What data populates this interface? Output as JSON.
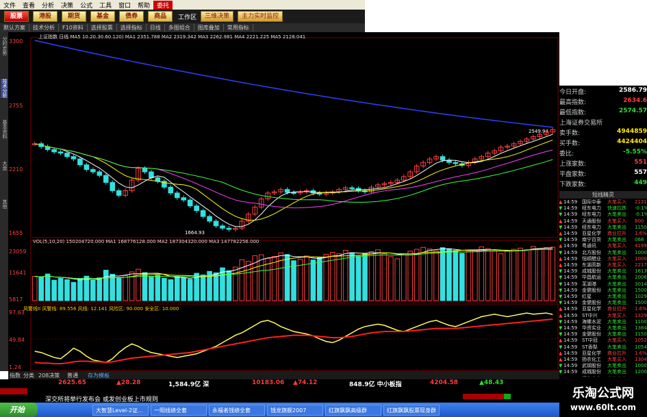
{
  "menu": [
    "文件",
    "查看",
    "分析",
    "决策",
    "公式",
    "工具",
    "窗口",
    "帮助",
    "委托"
  ],
  "toolbar": {
    "buttons": [
      "股票",
      "港股",
      "期货",
      "基金",
      "债券",
      "商品"
    ],
    "workspace_label": "工作区",
    "extra": [
      "三维决策",
      "主力实时监控"
    ]
  },
  "subtoolbar": [
    "默认方案",
    "技术分析",
    "F10资料",
    "选择股票",
    "选择指标",
    "日线",
    "多图组合",
    "图库叠加",
    "常用指标"
  ],
  "left_tabs": [
    "分时走势",
    "技术分析",
    "基本资料",
    "大盘",
    "其他"
  ],
  "chart": {
    "title_line": "上证指数 日线 MA5 10.20.30.60.120) MA1 2351.788 MA2 2319.342 MA3 2262.981 MA4 2221.225 MA5 2128.041",
    "price_ticks": [
      "3300",
      "2755",
      "2210",
      "1655"
    ],
    "low_label": "1664.93",
    "high_label": "2549.94",
    "vol_title": "VOL(5,10,20) 150204720.000 MA1 168776128.000 MA2 187304320.000 MA3 147782256.000",
    "vol_ticks": [
      "23059",
      "11641",
      "5817"
    ],
    "ind_title": "风警线II 风警线: 89.556 风线: 12.141 风险区: 90.000 安全区: 10.000",
    "ind_ticks": [
      "97.63",
      "49.84",
      "1.24"
    ],
    "date_ticks": [
      "2008/08",
      "09",
      "10",
      "11",
      "12",
      "2009/01",
      "02",
      "03"
    ]
  },
  "quote": {
    "rows": [
      {
        "k": "今日开盘:",
        "v": "2586.79",
        "c": "wht"
      },
      {
        "k": "最高指数:",
        "v": "2634.6",
        "c": "red"
      },
      {
        "k": "最低指数:",
        "v": "2574.57",
        "c": "grn"
      },
      {
        "k": "上海证券交易所",
        "v": "",
        "c": "wht"
      },
      {
        "k": "卖手数:",
        "v": "4944859",
        "c": "yel"
      },
      {
        "k": "买手数:",
        "v": "4424404",
        "c": "yel"
      },
      {
        "k": "委比:",
        "v": "-5.55%",
        "c": "grn"
      },
      {
        "k": "上涨家数:",
        "v": "551",
        "c": "red"
      },
      {
        "k": "平盘家数:",
        "v": "557",
        "c": "wht"
      },
      {
        "k": "下跌家数:",
        "v": "449",
        "c": "grn"
      }
    ],
    "trade_header": "短线精灵",
    "trades": [
      {
        "t": "14:59",
        "n": "国际中泰",
        "a": "大笔买入",
        "v": "2131"
      },
      {
        "t": "14:59",
        "n": "纽东电力",
        "a": "快速拉跌",
        "v": "-0.1%"
      },
      {
        "t": "14:59",
        "n": "纽东电力",
        "a": "大笔卖出",
        "v": "-0.1%"
      },
      {
        "t": "14:59",
        "n": "天通股份",
        "a": "大笔买入",
        "v": "800"
      },
      {
        "t": "14:59",
        "n": "纽东电力",
        "a": "大笔卖出",
        "v": "1150"
      },
      {
        "t": "14:59",
        "n": "亚星化学",
        "a": "商业拉升",
        "v": "1.6%"
      },
      {
        "t": "14:59",
        "n": "南宁百货",
        "a": "大笔卖出",
        "v": "068"
      },
      {
        "t": "14:59",
        "n": "粤通讯",
        "a": "大笔买入",
        "v": "4199"
      },
      {
        "t": "14:59",
        "n": "北方股份",
        "a": "大笔卖出",
        "v": "1000"
      },
      {
        "t": "14:59",
        "n": "恒顺醋业",
        "a": "大笔买入",
        "v": "1000"
      },
      {
        "t": "14:59",
        "n": "东湖高新",
        "a": "大笔买入",
        "v": "2217"
      },
      {
        "t": "14:59",
        "n": "成城股份",
        "a": "大笔卖出",
        "v": "1613"
      },
      {
        "t": "14:59",
        "n": "华昌航运",
        "a": "大笔卖出",
        "v": "2006"
      },
      {
        "t": "14:59",
        "n": "芜湖港",
        "a": "大笔卖出",
        "v": "3014"
      },
      {
        "t": "14:59",
        "n": "金健股份",
        "a": "大笔卖出",
        "v": "1500"
      },
      {
        "t": "14:59",
        "n": "红星",
        "a": "大笔卖出",
        "v": "1029"
      },
      {
        "t": "14:59",
        "n": "金健股份",
        "a": "大笔卖出",
        "v": "1500"
      },
      {
        "t": "14:59",
        "n": "亚星化学",
        "a": "商业拉升",
        "v": "1.6%"
      },
      {
        "t": "14:59",
        "n": "ST中兴",
        "a": "大笔买入",
        "v": "1329"
      },
      {
        "t": "14:59",
        "n": "海螺水泥",
        "a": "大笔卖出",
        "v": "1100"
      },
      {
        "t": "14:59",
        "n": "华资实业",
        "a": "大笔卖出",
        "v": "1384"
      },
      {
        "t": "14:59",
        "n": "金健股份",
        "a": "大笔卖出",
        "v": "1150"
      },
      {
        "t": "14:59",
        "n": "ST中冠",
        "a": "大笔买入",
        "v": "1052"
      },
      {
        "t": "14:59",
        "n": "ST香梨",
        "a": "大笔卖出",
        "v": "1054"
      },
      {
        "t": "14:59",
        "n": "亚星化学",
        "a": "商业拉升",
        "v": "1.6%"
      },
      {
        "t": "14:59",
        "n": "扬农化工",
        "a": "大笔买入",
        "v": "1304"
      },
      {
        "t": "14:59",
        "n": "武钢股份",
        "a": "大笔卖出",
        "v": "1000"
      },
      {
        "t": "14:59",
        "n": "成城股份",
        "a": "大笔卖出",
        "v": "1200"
      },
      {
        "t": "14:59",
        "n": "闽东电力",
        "a": "大笔卖出",
        "v": "1150"
      }
    ]
  },
  "bottom_tabs": [
    "指数",
    "分类",
    "208决策",
    "普通",
    "存为模板"
  ],
  "status": {
    "s1": "2625.65",
    "s2": "▲28.28",
    "s3": "1,584.9亿 深",
    "s4": "10183.06",
    "s5": "▲74.12",
    "s6": "848.9亿 中小板指",
    "s7": "4204.58",
    "s8": "▲48.43"
  },
  "ticker_text": "深交所将举行发布会 或发创业板上市规则",
  "taskbar": {
    "start": "开始",
    "tasks": [
      "大智慧Level-2证...",
      "一阳线绩全套",
      "永福者钱绩全套",
      "钱龙旗舰2007",
      "红旗飘飘高级群",
      "红旗飘飘股票现身群"
    ]
  },
  "promo": {
    "title": "乐淘公式网",
    "url": "www.60lt.com"
  },
  "chart_data": {
    "type": "candlestick",
    "price_range": [
      1655,
      3300
    ],
    "closes": [
      2420,
      2395,
      2370,
      2350,
      2340,
      2310,
      2290,
      2240,
      2200,
      2180,
      2150,
      2090,
      2020,
      1980,
      2020,
      2110,
      2210,
      2180,
      2130,
      2100,
      2050,
      2000,
      1960,
      1940,
      1890,
      1850,
      1800,
      1760,
      1720,
      1700,
      1690,
      1700,
      1760,
      1820,
      1880,
      1950,
      2000,
      2010,
      2030,
      2005,
      2000,
      2010,
      2020,
      2000,
      1990,
      2000,
      2010,
      2030,
      2045,
      2040,
      2020,
      2010,
      2050,
      2070,
      2080,
      2090,
      2110,
      2140,
      2180,
      2230,
      2260,
      2290,
      2310,
      2280,
      2260,
      2250,
      2235,
      2260,
      2290,
      2310,
      2340,
      2360,
      2390,
      2400,
      2420,
      2440,
      2460,
      2480,
      2500,
      2520,
      2540
    ],
    "volume_range": [
      0,
      23059
    ],
    "volumes": [
      10200,
      9800,
      11200,
      8600,
      9400,
      8800,
      7700,
      9100,
      10300,
      8500,
      9600,
      12800,
      11100,
      9700,
      10500,
      12100,
      13200,
      11800,
      9900,
      10700,
      9400,
      8800,
      10200,
      9600,
      9000,
      11500,
      10800,
      12300,
      11700,
      13800,
      12600,
      14100,
      17200,
      16500,
      18900,
      19300,
      17800,
      18600,
      20100,
      19400,
      16800,
      17400,
      18800,
      17100,
      18200,
      19500,
      20300,
      19700,
      21200,
      20100,
      18700,
      19900,
      20600,
      21400,
      19800,
      18500,
      17600,
      19300,
      20800,
      21600,
      22400,
      21700,
      20900,
      22300,
      21800,
      21100,
      19900,
      20700,
      21300,
      22600,
      21900,
      20800,
      19700,
      20900,
      21600,
      22100,
      21400,
      22800,
      21900,
      22300,
      22500
    ],
    "indicator_range": [
      1.24,
      97.63
    ],
    "indicator_yellow": [
      30,
      28,
      24,
      20,
      18,
      26,
      35,
      30,
      22,
      16,
      14,
      12,
      18,
      28,
      36,
      42,
      38,
      32,
      28,
      26,
      24,
      22,
      20,
      22,
      24,
      26,
      30,
      34,
      38,
      44,
      50,
      56,
      60,
      66,
      72,
      78,
      80,
      76,
      70,
      66,
      62,
      60,
      58,
      55,
      50,
      46,
      44,
      48,
      54,
      60,
      66,
      70,
      72,
      74,
      72,
      68,
      64,
      62,
      66,
      70,
      74,
      78,
      80,
      76,
      72,
      70,
      74,
      78,
      82,
      86,
      88,
      90,
      88,
      86,
      88,
      90,
      92,
      90,
      91,
      92,
      89.556
    ],
    "indicator_red": [
      12,
      11,
      11,
      10,
      10,
      11,
      13,
      14,
      14,
      13,
      13,
      12,
      13,
      15,
      17,
      19,
      20,
      21,
      22,
      23,
      24,
      25,
      26,
      27,
      28,
      30,
      32,
      34,
      36,
      38,
      40,
      42,
      44,
      46,
      48,
      50,
      52,
      53,
      54,
      55,
      56,
      56,
      56,
      55,
      54,
      53,
      52,
      52,
      53,
      54,
      56,
      58,
      60,
      61,
      62,
      62,
      62,
      62,
      63,
      64,
      65,
      66,
      67,
      67,
      67,
      67,
      68,
      69,
      70,
      71,
      72,
      73,
      74,
      75,
      76,
      77,
      78,
      79,
      80,
      81,
      82
    ]
  }
}
